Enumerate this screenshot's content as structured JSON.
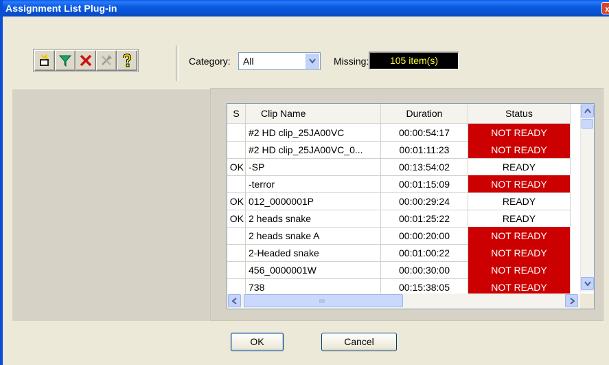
{
  "window": {
    "title": "Assignment List Plug-in",
    "close_glyph": "x"
  },
  "toolbar": {
    "buttons": [
      {
        "name": "new-clip-icon",
        "tooltip": ""
      },
      {
        "name": "filter-icon"
      },
      {
        "name": "delete-icon"
      },
      {
        "name": "tools-icon"
      },
      {
        "name": "help-icon"
      }
    ]
  },
  "category": {
    "label": "Category:",
    "value": "All"
  },
  "missing": {
    "label": "Missing:",
    "value": "105 item(s)"
  },
  "grid": {
    "columns": [
      "S",
      "Clip Name",
      "Duration",
      "Status"
    ],
    "rows": [
      {
        "s": "",
        "name": "#2 HD clip_25JA00VC",
        "duration": "00:00:54:17",
        "status": "NOT READY"
      },
      {
        "s": "",
        "name": "#2 HD clip_25JA00VC_0...",
        "duration": "00:01:11:23",
        "status": "NOT READY"
      },
      {
        "s": "OK",
        "name": "-SP",
        "duration": "00:13:54:02",
        "status": "READY"
      },
      {
        "s": "",
        "name": "-terror",
        "duration": "00:01:15:09",
        "status": "NOT READY"
      },
      {
        "s": "OK",
        "name": "012_0000001P",
        "duration": "00:00:29:24",
        "status": "READY"
      },
      {
        "s": "OK",
        "name": "2 heads snake",
        "duration": "00:01:25:22",
        "status": "READY"
      },
      {
        "s": "",
        "name": "2 heads snake A",
        "duration": "00:00:20:00",
        "status": "NOT READY"
      },
      {
        "s": "",
        "name": "2-Headed snake",
        "duration": "00:01:00:22",
        "status": "NOT READY"
      },
      {
        "s": "",
        "name": "456_0000001W",
        "duration": "00:00:30:00",
        "status": "NOT READY"
      },
      {
        "s": "",
        "name": "738",
        "duration": "00:15:38:05",
        "status": "NOT READY"
      }
    ]
  },
  "buttons": {
    "ok": "OK",
    "cancel": "Cancel"
  },
  "colors": {
    "title_bar": "#0a5ae6",
    "not_ready": "#cc0000",
    "missing_text": "#ffff40"
  }
}
